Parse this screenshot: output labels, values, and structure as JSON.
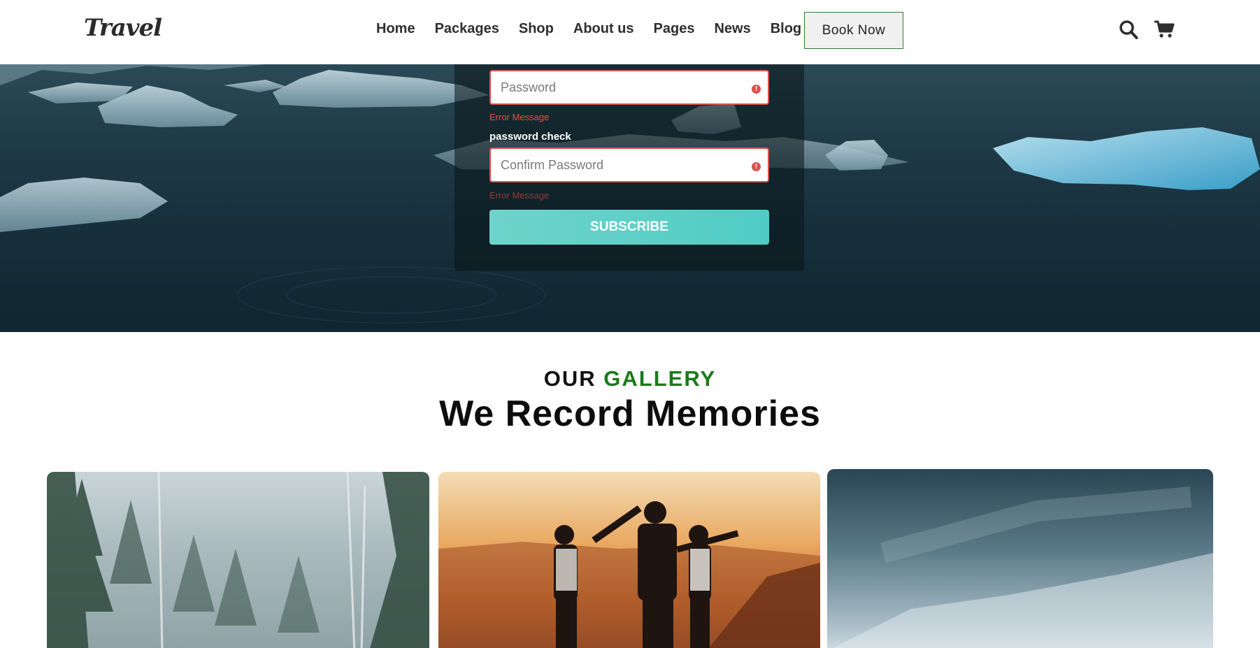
{
  "brand": {
    "logo": "Travel"
  },
  "nav": {
    "items": [
      "Home",
      "Packages",
      "Shop",
      "About us",
      "Pages",
      "News",
      "Blog"
    ],
    "book_label": "Book Now",
    "icons": [
      "search-icon",
      "cart-icon"
    ]
  },
  "form": {
    "password_placeholder": "Password",
    "password_error": "Error Message",
    "confirm_label": "password check",
    "confirm_placeholder": "Confirm Password",
    "confirm_error": "Error Message",
    "subscribe_label": "SUBSCRIBE",
    "error_color": "#d9534f",
    "button_color": "#4ecdc4"
  },
  "gallery": {
    "kicker_prefix": "OUR",
    "kicker_accent": "GALLERY",
    "accent_color": "#1a7a1a",
    "title": "We Record Memories",
    "cards": [
      "misty-forest-photo",
      "friends-sunset-photo",
      "sky-photo"
    ]
  }
}
